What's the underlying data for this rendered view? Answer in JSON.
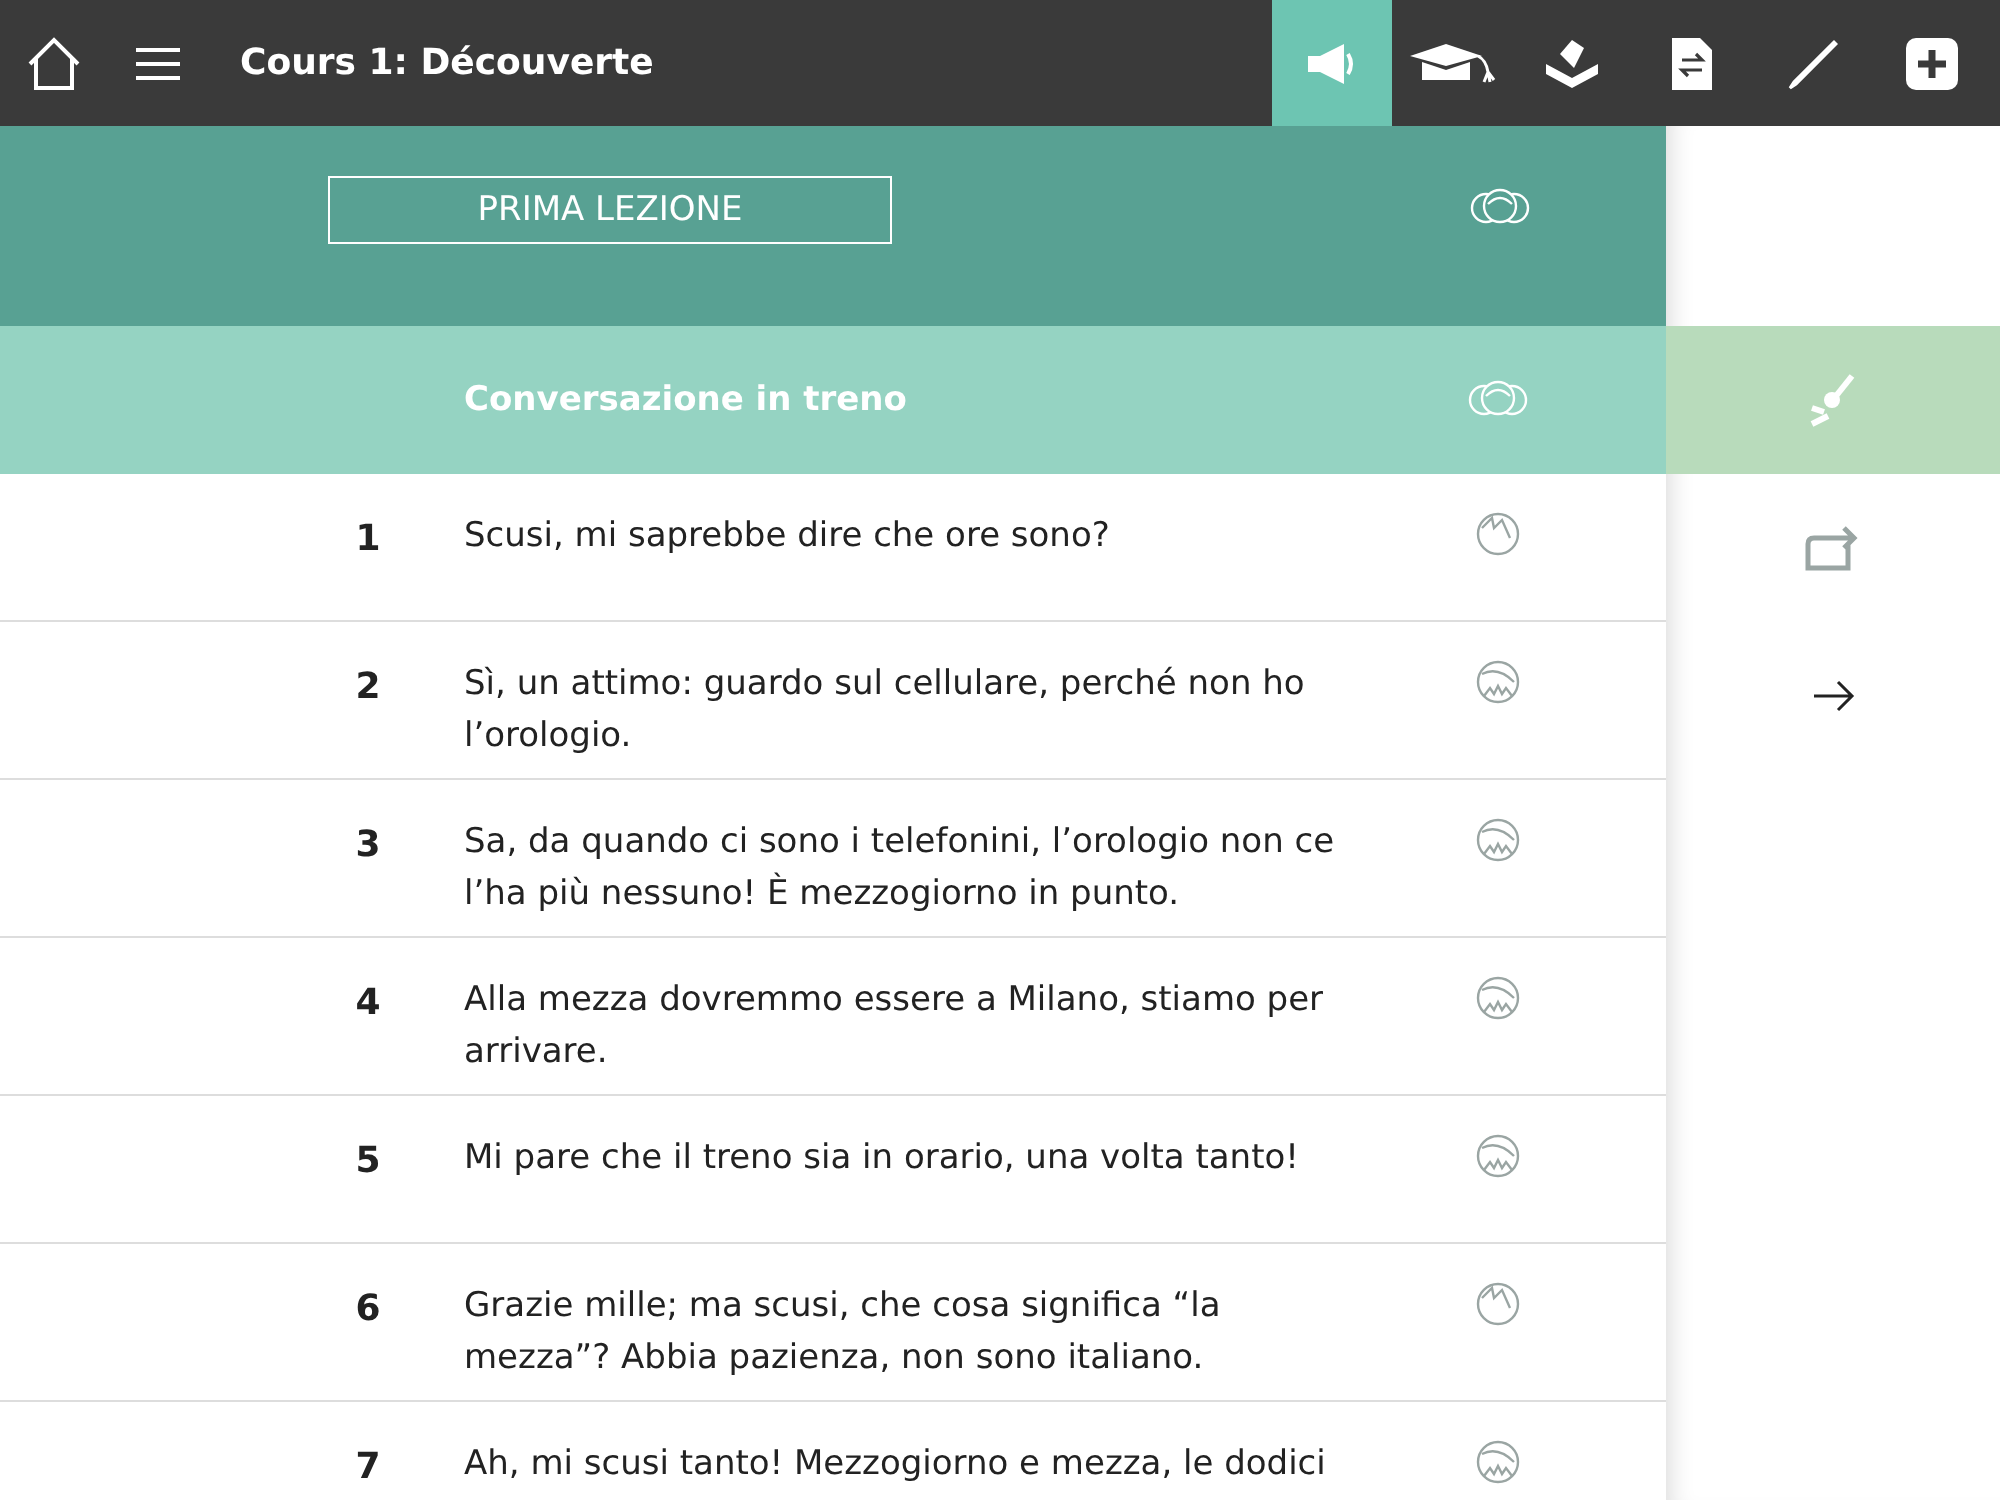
{
  "top_bar": {
    "title": "Cours 1: Découverte",
    "tools": [
      {
        "kind": "megaphone",
        "selected": true
      },
      {
        "kind": "cap",
        "selected": false
      },
      {
        "kind": "tray",
        "selected": false
      },
      {
        "kind": "document",
        "selected": false
      },
      {
        "kind": "pen",
        "selected": false
      },
      {
        "kind": "plus",
        "selected": false
      }
    ]
  },
  "lesson": {
    "title": "PRIMA LEZIONE"
  },
  "section": {
    "title": "Conversazione in treno"
  },
  "lines": [
    {
      "number": "1",
      "text": "Scusi, mi saprebbe dire che ore sono?",
      "kind": "spiky"
    },
    {
      "number": "2",
      "text": "Sì, un attimo: guardo sul cellulare, perché non ho l’orologio.",
      "kind": "bearded"
    },
    {
      "number": "3",
      "text": "Sa, da quando ci sono i telefonini, l’orologio non ce l’ha più nessuno! È mezzogiorno in punto.",
      "kind": "bearded"
    },
    {
      "number": "4",
      "text": "Alla mezza dovremmo essere a Milano, stiamo per arrivare.",
      "kind": "bearded"
    },
    {
      "number": "5",
      "text": "Mi pare che il treno sia in orario, una volta tanto!",
      "kind": "bearded"
    },
    {
      "number": "6",
      "text": "Grazie mille; ma scusi, che cosa significa “la mezza”? Abbia pazienza, non sono italiano.",
      "kind": "spiky"
    },
    {
      "number": "7",
      "text": "Ah, mi scusi tanto! Mezzogiorno e mezza, le dodici",
      "kind": "bearded"
    }
  ],
  "side_panel": {
    "actions": [
      {
        "kind": "brush",
        "selected": true
      },
      {
        "kind": "repeat",
        "selected": false
      },
      {
        "kind": "arrow",
        "selected": false
      }
    ]
  }
}
